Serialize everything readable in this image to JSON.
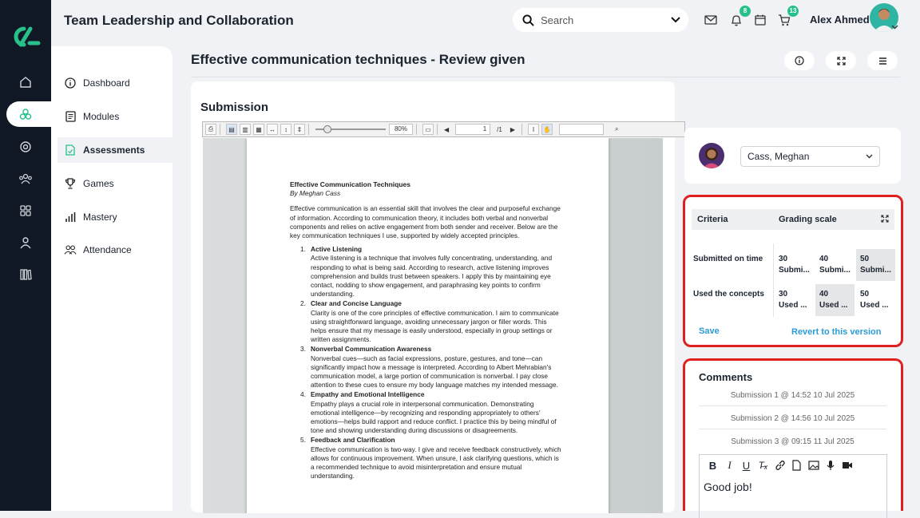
{
  "app": {
    "title": "Team Leadership and Collaboration"
  },
  "search": {
    "placeholder": "Search"
  },
  "notifications": {
    "bell_count": "8",
    "cart_count": "13"
  },
  "user": {
    "name": "Alex Ahmed"
  },
  "sidebar": {
    "items": [
      {
        "label": "Dashboard",
        "icon": "info-icon"
      },
      {
        "label": "Modules",
        "icon": "modules-icon"
      },
      {
        "label": "Assessments",
        "icon": "assessment-icon",
        "active": true
      },
      {
        "label": "Games",
        "icon": "trophy-icon"
      },
      {
        "label": "Mastery",
        "icon": "bar-chart-icon"
      },
      {
        "label": "Attendance",
        "icon": "people-icon"
      }
    ]
  },
  "page": {
    "title": "Effective communication techniques - Review given"
  },
  "submission": {
    "heading": "Submission",
    "viewer": {
      "zoom": "80%",
      "page_current": "1",
      "page_total": "/1"
    },
    "document": {
      "title": "Effective Communication Techniques",
      "author": "By Meghan Cass",
      "intro": "Effective communication is an essential skill that involves the clear and purposeful exchange of information. According to communication theory, it includes both verbal and nonverbal components and relies on active engagement from both sender and receiver. Below are the key communication techniques I use, supported by widely accepted principles.",
      "items": [
        {
          "num": "1.",
          "title": "Active Listening",
          "text": "Active listening is a technique that involves fully concentrating, understanding, and responding to what is being said. According to research, active listening improves comprehension and builds trust between speakers. I apply this by maintaining eye contact, nodding to show engagement, and paraphrasing key points to confirm understanding."
        },
        {
          "num": "2.",
          "title": "Clear and Concise Language",
          "text": "Clarity is one of the core principles of effective communication. I aim to communicate using straightforward language, avoiding unnecessary jargon or filler words. This helps ensure that my message is easily understood, especially in group settings or written assignments."
        },
        {
          "num": "3.",
          "title": "Nonverbal Communication Awareness",
          "text": "Nonverbal cues—such as facial expressions, posture, gestures, and tone—can significantly impact how a message is interpreted. According to Albert Mehrabian's communication model, a large portion of communication is nonverbal. I pay close attention to these cues to ensure my body language matches my intended message."
        },
        {
          "num": "4.",
          "title": "Empathy and Emotional Intelligence",
          "text": "Empathy plays a crucial role in interpersonal communication. Demonstrating emotional intelligence—by recognizing and responding appropriately to others' emotions—helps build rapport and reduce conflict. I practice this by being mindful of tone and showing understanding during discussions or disagreements."
        },
        {
          "num": "5.",
          "title": "Feedback and Clarification",
          "text": "Effective communication is two-way. I give and receive feedback constructively, which allows for continuous improvement. When unsure, I ask clarifying questions, which is a recommended technique to avoid misinterpretation and ensure mutual understanding."
        }
      ]
    }
  },
  "student": {
    "selected": "Cass, Meghan"
  },
  "rubric": {
    "header_criteria": "Criteria",
    "header_scale": "Grading scale",
    "rows": [
      {
        "criterion": "Submitted on time",
        "cells": [
          {
            "points": "30",
            "label": "Submi...",
            "selected": false
          },
          {
            "points": "40",
            "label": "Submi...",
            "selected": false
          },
          {
            "points": "50",
            "label": "Submi...",
            "selected": true
          }
        ]
      },
      {
        "criterion": "Used the concepts",
        "cells": [
          {
            "points": "30",
            "label": "Used ...",
            "selected": false
          },
          {
            "points": "40",
            "label": "Used ...",
            "selected": true
          },
          {
            "points": "50",
            "label": "Used ...",
            "selected": false
          }
        ]
      }
    ],
    "save_label": "Save",
    "revert_label": "Revert to this version"
  },
  "comments": {
    "heading": "Comments",
    "submissions": [
      "Submission 1 @ 14:52 10 Jul 2025",
      "Submission 2 @ 14:56 10 Jul 2025",
      "Submission 3 @ 09:15 11 Jul 2025"
    ],
    "editor_text": "Good job!"
  },
  "colors": {
    "rail": "#101826",
    "accent": "#27c08a",
    "link": "#2b9bd6",
    "highlight_border": "#e02020"
  }
}
